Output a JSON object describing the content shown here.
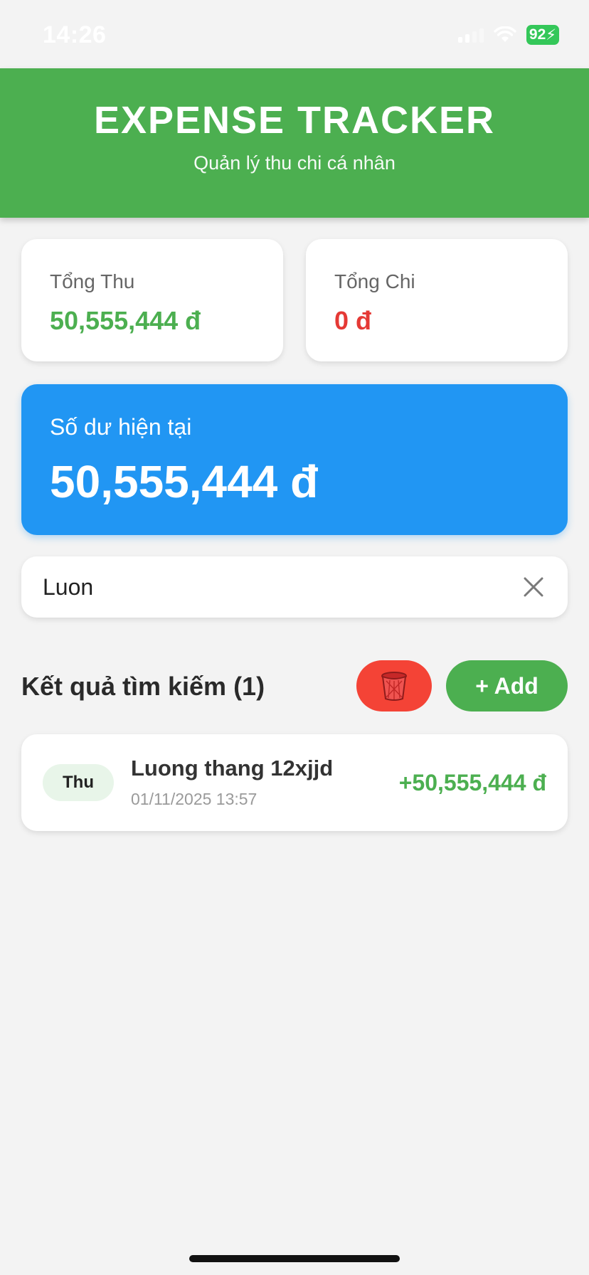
{
  "status_bar": {
    "time": "14:26",
    "battery": "92"
  },
  "header": {
    "title": "EXPENSE TRACKER",
    "subtitle": "Quản lý thu chi cá nhân"
  },
  "summary": {
    "income": {
      "label": "Tổng Thu",
      "value": "50,555,444 đ"
    },
    "expense": {
      "label": "Tổng Chi",
      "value": "0 đ"
    }
  },
  "balance": {
    "label": "Số dư hiện tại",
    "value": "50,555,444 đ"
  },
  "search": {
    "value": "Luon",
    "clear_icon": "close-icon"
  },
  "results": {
    "title": "Kết quả tìm kiếm (1)",
    "delete_icon": "trash-icon",
    "add_label": "+ Add"
  },
  "transactions": [
    {
      "type": "Thu",
      "name": "Luong thang 12xjjd",
      "datetime": "01/11/2025 13:57",
      "amount": "+50,555,444 đ"
    }
  ],
  "colors": {
    "header": "#4caf50",
    "income": "#4caf50",
    "expense": "#e53935",
    "balance": "#2196f3",
    "delete": "#f44336"
  }
}
